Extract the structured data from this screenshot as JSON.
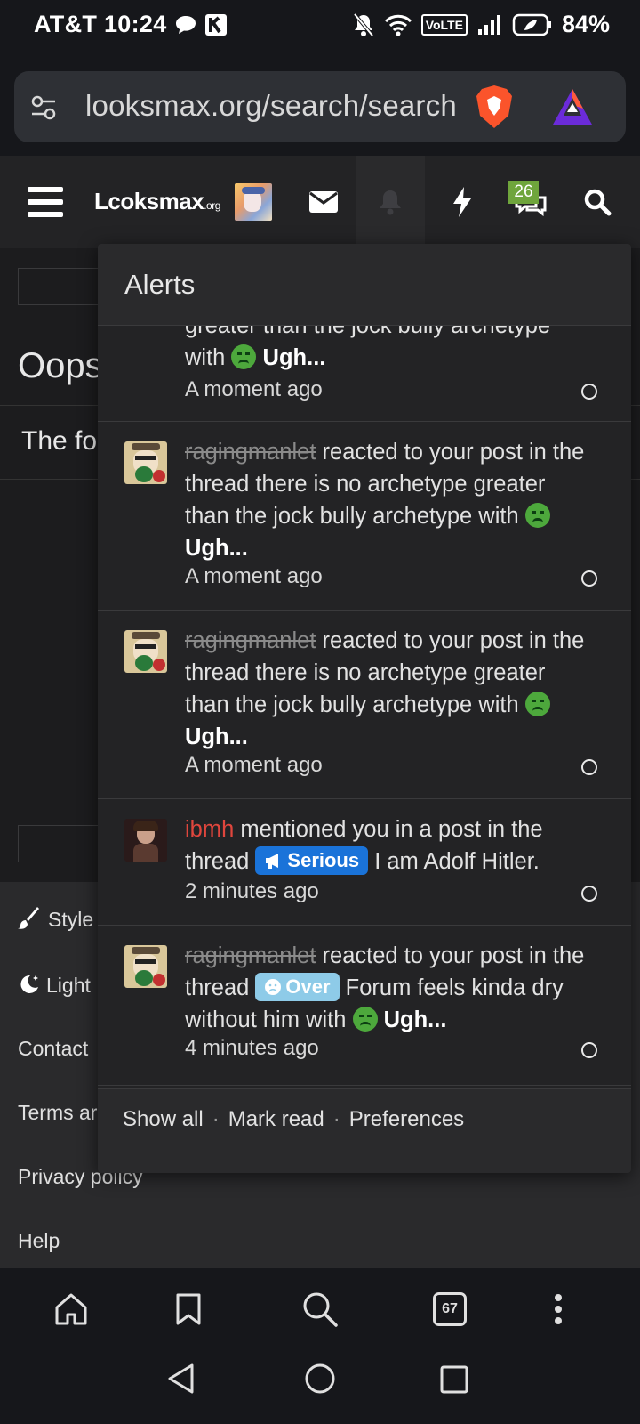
{
  "status_bar": {
    "carrier_time": "AT&T 10:24",
    "volte": "VoLTE",
    "battery": "84%"
  },
  "browser": {
    "url": "looksmax.org/search/search",
    "tab_count": "67"
  },
  "site_nav": {
    "logo_main": "Lcoksmax",
    "logo_suffix": ".org",
    "conversations_badge": "26"
  },
  "background_page": {
    "heading": "Oops",
    "text": "The fo",
    "footer_links": [
      "Style",
      "Light",
      "Contact",
      "Terms ar",
      "Privacy policy",
      "Help"
    ]
  },
  "alerts": {
    "title": "Alerts",
    "partial_item": {
      "text_top": "greater than the jock bully archetype",
      "text_with": "with",
      "reaction": "Ugh...",
      "time": "A moment ago"
    },
    "items": [
      {
        "user": "ragingmanlet",
        "action": "reacted to your post in the thread there is no archetype greater than the jock bully archetype with",
        "reaction": "Ugh...",
        "time": "A moment ago"
      },
      {
        "user": "ragingmanlet",
        "action": "reacted to your post in the thread there is no archetype greater than the jock bully archetype with",
        "reaction": "Ugh...",
        "time": "A moment ago"
      },
      {
        "user": "ibmh",
        "action": "mentioned you in a post in the thread",
        "label": "Serious",
        "thread": "I am Adolf Hitler.",
        "time": "2 minutes ago"
      },
      {
        "user": "ragingmanlet",
        "action_pre": "reacted to your post in the thread",
        "label": "Over",
        "thread": "Forum feels kinda dry without him with",
        "reaction": "Ugh...",
        "time": "4 minutes ago"
      }
    ],
    "footer": {
      "show_all": "Show all",
      "mark_read": "Mark read",
      "preferences": "Preferences",
      "separator": "·"
    }
  },
  "colors": {
    "user_red": "#e0463d",
    "serious_label": "#1a73d9",
    "over_label": "#8ecbe8",
    "badge_green": "#6fa53c"
  }
}
